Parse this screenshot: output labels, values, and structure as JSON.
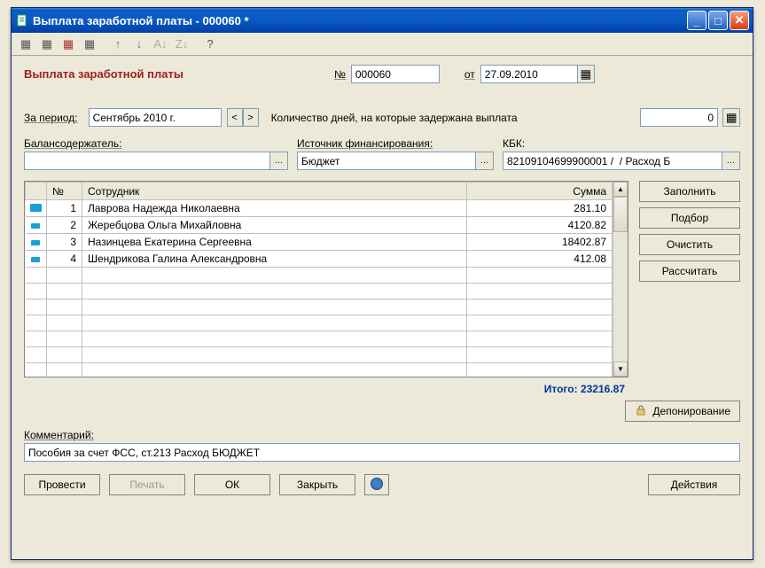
{
  "window": {
    "title": "Выплата заработной платы - 000060 *"
  },
  "header": {
    "doc_title": "Выплата заработной платы",
    "num_label": "№",
    "num_value": "000060",
    "date_label": "от",
    "date_value": "27.09.2010"
  },
  "period": {
    "label": "За период:",
    "value": "Сентябрь 2010 г.",
    "days_label": "Количество дней, на которые задержана выплата",
    "days_value": "0"
  },
  "fields": {
    "balance_label": "Балансодержатель:",
    "balance_value": "",
    "source_label": "Источник финансирования:",
    "source_value": "Бюджет",
    "kbk_label": "КБК:",
    "kbk_value": "82109104699900001 /  / Расход Б"
  },
  "table": {
    "headers": {
      "num": "№",
      "employee": "Сотрудник",
      "sum": "Сумма"
    },
    "rows": [
      {
        "n": "1",
        "employee": "Лаврова Надежда Николаевна",
        "sum": "281.10",
        "sel": true
      },
      {
        "n": "2",
        "employee": "Жеребцова Ольга Михайловна",
        "sum": "4120.82",
        "sel": false
      },
      {
        "n": "3",
        "employee": "Назинцева Екатерина Сергеевна",
        "sum": "18402.87",
        "sel": false
      },
      {
        "n": "4",
        "employee": "Шендрикова Галина Александровна",
        "sum": "412.08",
        "sel": false
      }
    ]
  },
  "side_buttons": {
    "fill": "Заполнить",
    "select": "Подбор",
    "clear": "Очистить",
    "calc": "Рассчитать"
  },
  "totals": {
    "label": "Итого:",
    "value": "23216.87"
  },
  "depo_button": "Депонирование",
  "comment": {
    "label": "Комментарий:",
    "value": "Пособия за счет ФСС, ст.213 Расход БЮДЖЕТ"
  },
  "bottom": {
    "post": "Провести",
    "print": "Печать",
    "ok": "ОК",
    "close": "Закрыть",
    "actions": "Действия"
  }
}
